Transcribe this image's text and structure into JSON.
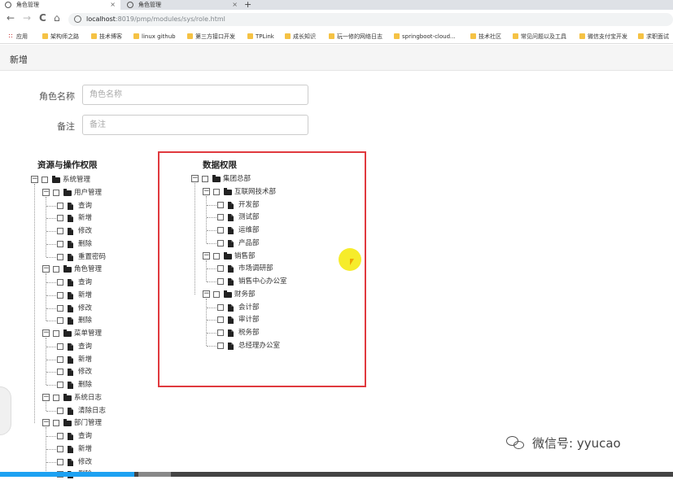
{
  "browser": {
    "tabs": [
      {
        "title": "角色管理",
        "active": true
      },
      {
        "title": "角色管理",
        "active": false
      }
    ],
    "new_tab": "+",
    "tab_close": "×",
    "nav": {
      "back": "←",
      "forward": "→",
      "reload": "C",
      "home": "⌂"
    },
    "url_host": "localhost",
    "url_path": ":8019/pmp/modules/sys/role.html",
    "bookmarks": [
      "应用",
      "架构师之路",
      "技术博客",
      "linux github",
      "第三方接口开发",
      "TPLink",
      "成长知识",
      "玩一修的网络日志",
      "springboot-cloud...",
      "技术社区",
      "常见问题以及工具",
      "微信支付宝开发",
      "求职面试"
    ]
  },
  "page": {
    "header": "新增",
    "form": {
      "role_name_label": "角色名称",
      "role_name_placeholder": "角色名称",
      "remark_label": "备注",
      "remark_placeholder": "备注"
    },
    "resource_title": "资源与操作权限",
    "data_title": "数据权限",
    "resource_tree": [
      {
        "label": "系统管理",
        "type": "folder",
        "children": [
          {
            "label": "用户管理",
            "type": "folder",
            "children": [
              {
                "label": "查询",
                "type": "file"
              },
              {
                "label": "新增",
                "type": "file"
              },
              {
                "label": "修改",
                "type": "file"
              },
              {
                "label": "删除",
                "type": "file"
              },
              {
                "label": "重置密码",
                "type": "file"
              }
            ]
          },
          {
            "label": "角色管理",
            "type": "folder",
            "children": [
              {
                "label": "查询",
                "type": "file"
              },
              {
                "label": "新增",
                "type": "file"
              },
              {
                "label": "修改",
                "type": "file"
              },
              {
                "label": "删除",
                "type": "file"
              }
            ]
          },
          {
            "label": "菜单管理",
            "type": "folder",
            "children": [
              {
                "label": "查询",
                "type": "file"
              },
              {
                "label": "新增",
                "type": "file"
              },
              {
                "label": "修改",
                "type": "file"
              },
              {
                "label": "删除",
                "type": "file"
              }
            ]
          },
          {
            "label": "系统日志",
            "type": "folder",
            "children": [
              {
                "label": "清除日志",
                "type": "file"
              }
            ]
          },
          {
            "label": "部门管理",
            "type": "folder",
            "children": [
              {
                "label": "查询",
                "type": "file"
              },
              {
                "label": "新增",
                "type": "file"
              },
              {
                "label": "修改",
                "type": "file"
              },
              {
                "label": "删除",
                "type": "file"
              }
            ]
          }
        ]
      }
    ],
    "data_tree": [
      {
        "label": "集团总部",
        "type": "folder",
        "children": [
          {
            "label": "互联网技术部",
            "type": "folder",
            "children": [
              {
                "label": "开发部",
                "type": "file"
              },
              {
                "label": "测试部",
                "type": "file"
              },
              {
                "label": "运维部",
                "type": "file"
              },
              {
                "label": "产品部",
                "type": "file"
              }
            ]
          },
          {
            "label": "销售部",
            "type": "folder",
            "children": [
              {
                "label": "市场调研部",
                "type": "file"
              },
              {
                "label": "销售中心办公室",
                "type": "file"
              }
            ]
          },
          {
            "label": "财务部",
            "type": "folder",
            "children": [
              {
                "label": "会计部",
                "type": "file"
              },
              {
                "label": "审计部",
                "type": "file"
              },
              {
                "label": "税务部",
                "type": "file"
              },
              {
                "label": "总经理办公室",
                "type": "file"
              }
            ]
          }
        ]
      }
    ]
  },
  "watermark": "微信号: yyucao",
  "video_progress": 0.2,
  "colors": {
    "highlight_box": "#e0393e",
    "cursor_highlight": "#f5ea14",
    "progress": "#1da1f2"
  }
}
